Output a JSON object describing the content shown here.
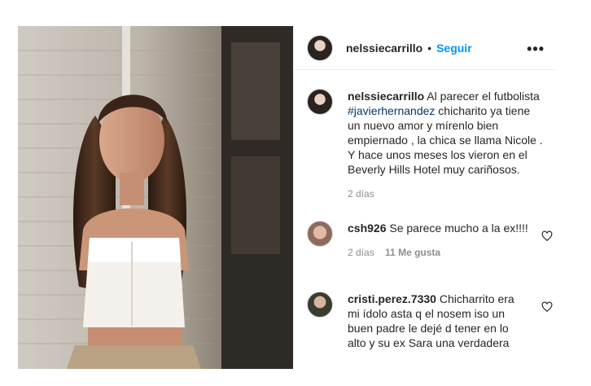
{
  "post": {
    "author": "nelssiecarrillo",
    "separator": "•",
    "follow_label": "Seguir",
    "more_label": "•••"
  },
  "caption": {
    "user": "nelssiecarrillo",
    "text_before": "Al parecer el futbolista",
    "hashtag": "#javierhernandez",
    "text_after": "chicharito ya tiene un nuevo amor y mírenlo bien empiernado , la chica se llama Nicole . Y hace unos meses los vieron en el Beverly Hills Hotel muy cariñosos.",
    "time": "2 días"
  },
  "comments": [
    {
      "user": "csh926",
      "text": "Se parece mucho a la ex!!!!",
      "time": "2 días",
      "likes": "11 Me gusta"
    },
    {
      "user": "cristi.perez.7330",
      "text": "Chicharrito era mi ídolo asta q el nosem iso un buen padre le dejé d tener en lo alto y su ex Sara una verdadera"
    }
  ],
  "icons": {
    "heart": "heart-icon",
    "more": "more-options-icon"
  }
}
